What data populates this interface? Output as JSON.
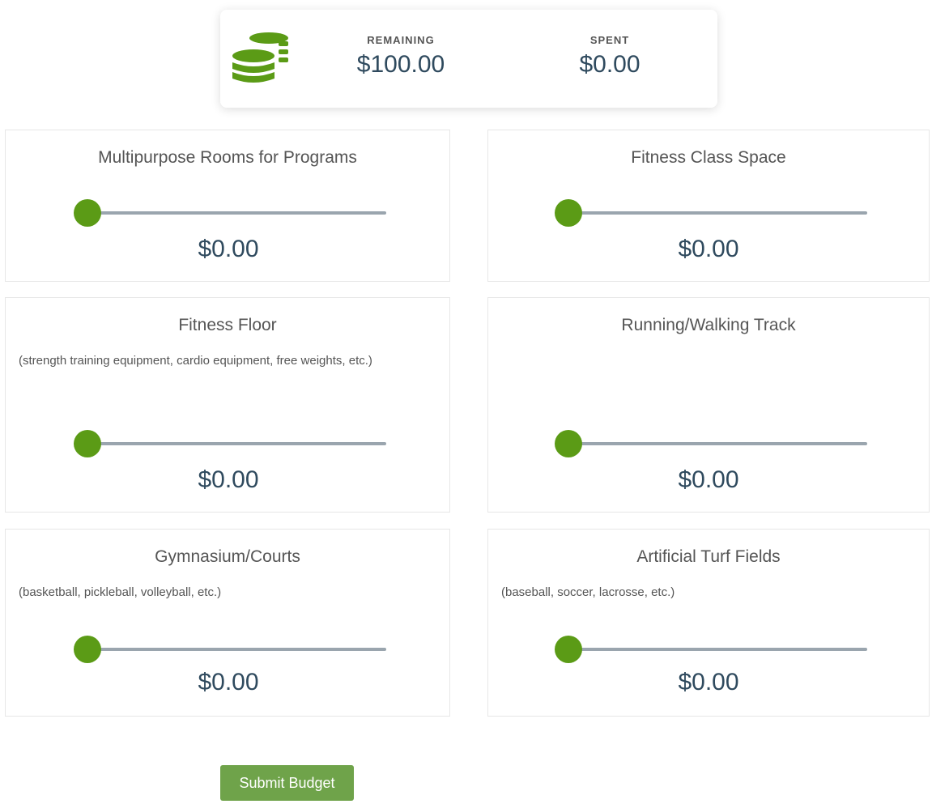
{
  "summary": {
    "icon": "coins-icon",
    "remaining_label": "REMAINING",
    "remaining_value": "$100.00",
    "spent_label": "SPENT",
    "spent_value": "$0.00"
  },
  "colors": {
    "accent": "#5b9b16",
    "submit_button": "#6fa34a",
    "track": "#9aa5ae",
    "amount_text": "#2f4a5e"
  },
  "items": [
    {
      "title": "Multipurpose Rooms for Programs",
      "description": "",
      "amount": "$0.00",
      "slider_fraction": 0
    },
    {
      "title": "Fitness Class Space",
      "description": "",
      "amount": "$0.00",
      "slider_fraction": 0
    },
    {
      "title": "Fitness Floor",
      "description": "(strength training equipment, cardio equipment, free weights, etc.)",
      "amount": "$0.00",
      "slider_fraction": 0
    },
    {
      "title": "Running/Walking Track",
      "description": "",
      "amount": "$0.00",
      "slider_fraction": 0
    },
    {
      "title": "Gymnasium/Courts",
      "description": "(basketball, pickleball, volleyball, etc.)",
      "amount": "$0.00",
      "slider_fraction": 0
    },
    {
      "title": "Artificial Turf Fields",
      "description": "(baseball, soccer, lacrosse, etc.)",
      "amount": "$0.00",
      "slider_fraction": 0
    }
  ],
  "submit": {
    "label": "Submit Budget"
  }
}
